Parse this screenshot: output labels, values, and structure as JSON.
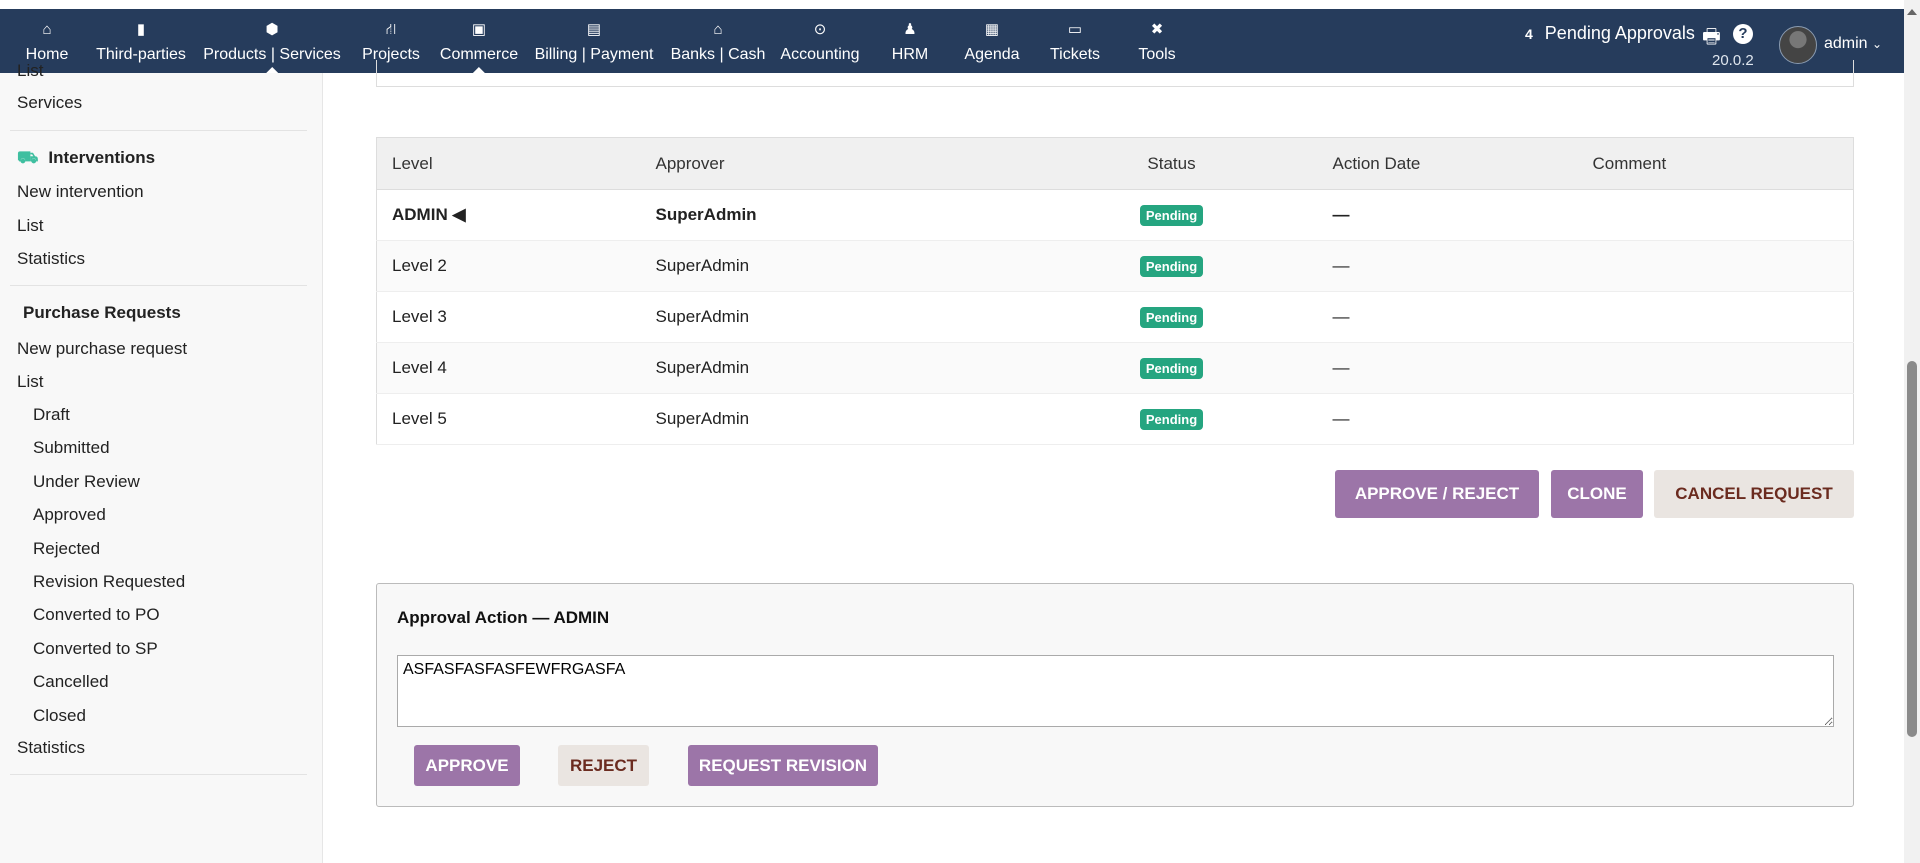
{
  "nav": {
    "items": [
      {
        "label": "Home",
        "icon": "home-icon",
        "glyph": "⌂"
      },
      {
        "label": "Third-parties",
        "icon": "building-icon",
        "glyph": "▮"
      },
      {
        "label": "Products | Services",
        "icon": "cube-icon",
        "glyph": "⬢"
      },
      {
        "label": "Projects",
        "icon": "sitemap-icon",
        "glyph": "⛙"
      },
      {
        "label": "Commerce",
        "icon": "suitcase-icon",
        "glyph": "▣"
      },
      {
        "label": "Billing | Payment",
        "icon": "invoice-icon",
        "glyph": "▤"
      },
      {
        "label": "Banks | Cash",
        "icon": "bank-icon",
        "glyph": "⌂"
      },
      {
        "label": "Accounting",
        "icon": "search-dollar-icon",
        "glyph": "⊙"
      },
      {
        "label": "HRM",
        "icon": "user-tie-icon",
        "glyph": "♟"
      },
      {
        "label": "Agenda",
        "icon": "calendar-icon",
        "glyph": "▦"
      },
      {
        "label": "Tickets",
        "icon": "ticket-icon",
        "glyph": "▭"
      },
      {
        "label": "Tools",
        "icon": "tools-icon",
        "glyph": "✖"
      }
    ],
    "pending_count": "4",
    "pending_label": "Pending Approvals",
    "version": "20.0.2",
    "user": "admin"
  },
  "sidebar": {
    "cut_item": "List",
    "services": "Services",
    "interventions": {
      "title": "Interventions",
      "items": [
        "New intervention",
        "List",
        "Statistics"
      ]
    },
    "purchase": {
      "title": "Purchase Requests",
      "new": "New purchase request",
      "list": "List",
      "statuses": [
        "Draft",
        "Submitted",
        "Under Review",
        "Approved",
        "Rejected",
        "Revision Requested",
        "Converted to PO",
        "Converted to SP",
        "Cancelled",
        "Closed"
      ],
      "statistics": "Statistics"
    }
  },
  "table": {
    "headers": [
      "Level",
      "Approver",
      "Status",
      "Action Date",
      "Comment"
    ],
    "rows": [
      {
        "level": "ADMIN ◀",
        "approver": "SuperAdmin",
        "status": "Pending",
        "date": "—",
        "comment": ""
      },
      {
        "level": "Level 2",
        "approver": "SuperAdmin",
        "status": "Pending",
        "date": "—",
        "comment": ""
      },
      {
        "level": "Level 3",
        "approver": "SuperAdmin",
        "status": "Pending",
        "date": "—",
        "comment": ""
      },
      {
        "level": "Level 4",
        "approver": "SuperAdmin",
        "status": "Pending",
        "date": "—",
        "comment": ""
      },
      {
        "level": "Level 5",
        "approver": "SuperAdmin",
        "status": "Pending",
        "date": "—",
        "comment": ""
      }
    ]
  },
  "actions": {
    "approve_reject": "APPROVE / REJECT",
    "clone": "CLONE",
    "cancel": "CANCEL REQUEST"
  },
  "approval": {
    "title": "Approval Action — ADMIN",
    "comment": "ASFASFASFASFEWFRGASFA",
    "approve": "APPROVE",
    "reject": "REJECT",
    "revision": "REQUEST REVISION"
  },
  "colors": {
    "nav": "#263c5c",
    "primary": "#9c75a8",
    "secondary": "#eae5e1",
    "badge": "#25a580"
  }
}
